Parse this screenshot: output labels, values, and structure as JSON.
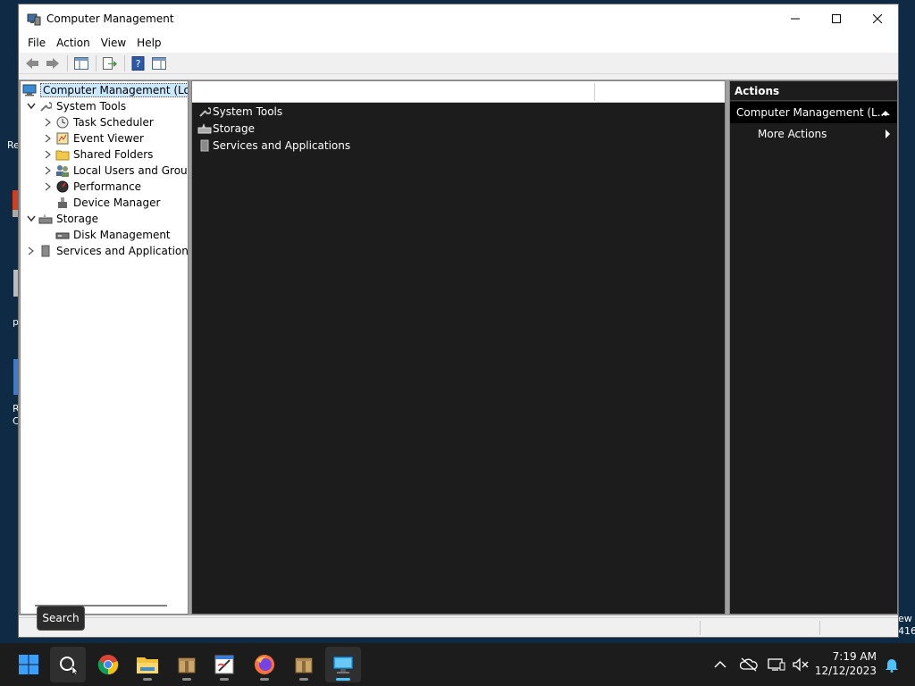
{
  "window": {
    "title": "Computer Management",
    "controls": {
      "minimize": "minimize",
      "maximize": "maximize",
      "close": "close"
    }
  },
  "menu": [
    "File",
    "Action",
    "View",
    "Help"
  ],
  "toolbar": {
    "buttons": [
      "back-arrow-icon",
      "forward-arrow-icon",
      "show-hide-console-tree-icon",
      "export-list-icon",
      "help-icon",
      "show-hide-action-pane-icon"
    ]
  },
  "tree": {
    "root": "Computer Management (Local",
    "items": [
      {
        "label": "System Tools",
        "icon": "wrench-icon"
      },
      {
        "label": "Task Scheduler",
        "icon": "clock-icon"
      },
      {
        "label": "Event Viewer",
        "icon": "event-viewer-icon"
      },
      {
        "label": "Shared Folders",
        "icon": "shared-folder-icon"
      },
      {
        "label": "Local Users and Groups",
        "icon": "users-icon"
      },
      {
        "label": "Performance",
        "icon": "performance-icon"
      },
      {
        "label": "Device Manager",
        "icon": "device-manager-icon"
      },
      {
        "label": "Storage",
        "icon": "storage-icon"
      },
      {
        "label": "Disk Management",
        "icon": "disk-icon"
      },
      {
        "label": "Services and Applications",
        "icon": "services-icon"
      }
    ]
  },
  "middle": {
    "items": [
      {
        "label": "System Tools",
        "icon": "wrench-icon"
      },
      {
        "label": "Storage",
        "icon": "storage-icon"
      },
      {
        "label": "Services and Applications",
        "icon": "services-icon"
      }
    ]
  },
  "actions": {
    "header": "Actions",
    "group": "Computer Management (L...",
    "items": [
      "More Actions"
    ]
  },
  "tooltip": "Search",
  "desktop_fragments": [
    "Re",
    "p",
    "R",
    "C",
    "ew",
    "416"
  ],
  "taskbar": {
    "apps": [
      "start-icon",
      "search-icon",
      "chrome-icon",
      "file-explorer-icon",
      "package-icon",
      "paint-icon",
      "firefox-icon",
      "package-icon",
      "computer-management-icon"
    ],
    "clock_time": "7:19 AM",
    "clock_date": "12/12/2023"
  },
  "colors": {
    "accent": "#4cc2ff",
    "pane_dark": "#1c1c1c",
    "selection": "#cce8ff"
  }
}
